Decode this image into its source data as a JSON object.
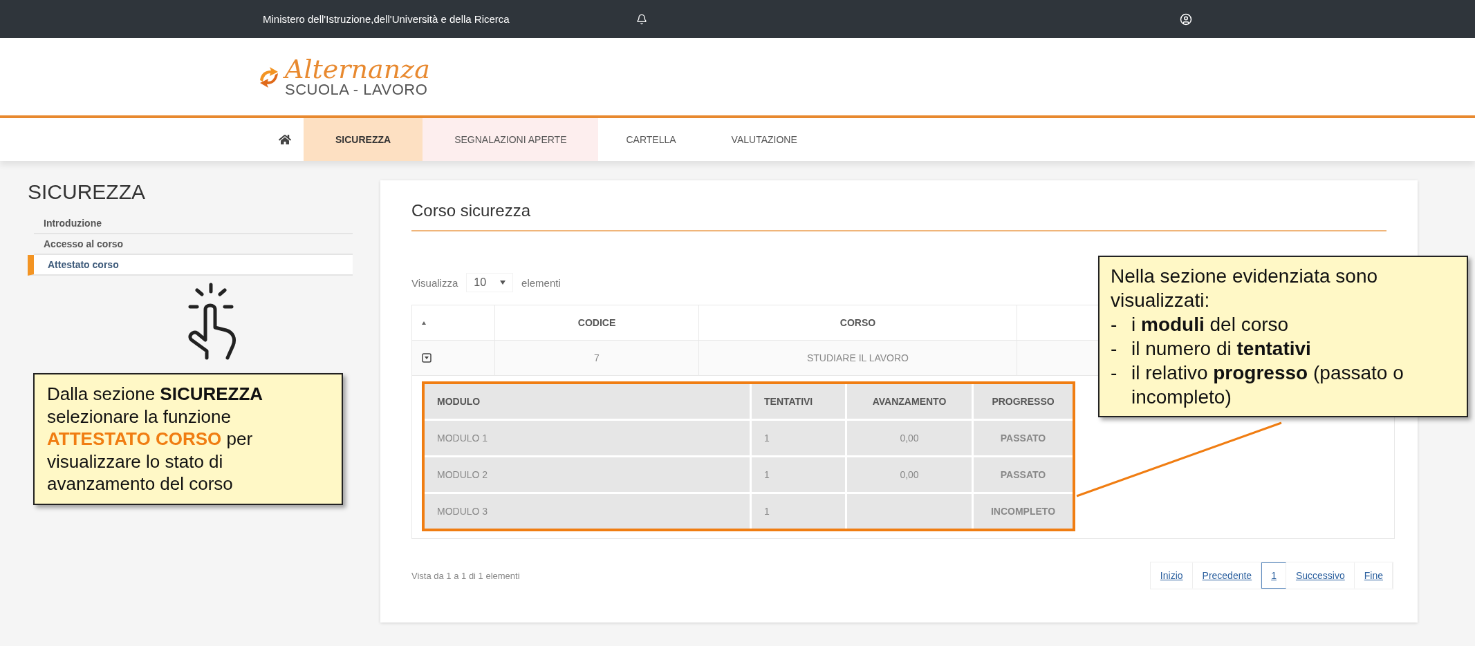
{
  "top_bar": {
    "ministry": "Ministero dell'Istruzione,dell'Università e della Ricerca"
  },
  "logo": {
    "script": "Alternanza",
    "subtitle": "SCUOLA - LAVORO"
  },
  "nav": [
    {
      "label": "SICUREZZA",
      "selected": true,
      "highlighted": false
    },
    {
      "label": "SEGNALAZIONI APERTE",
      "selected": false,
      "highlighted": true
    },
    {
      "label": "CARTELLA",
      "selected": false,
      "highlighted": false
    },
    {
      "label": "VALUTAZIONE",
      "selected": false,
      "highlighted": false
    }
  ],
  "sidebar": {
    "title": "SICUREZZA",
    "items": [
      {
        "label": "Introduzione",
        "selected": false
      },
      {
        "label": "Accesso al corso",
        "selected": false
      },
      {
        "label": "Attestato corso",
        "selected": true
      }
    ]
  },
  "card": {
    "title": "Corso sicurezza",
    "page_size": {
      "before": "Visualizza",
      "value": "10",
      "after": "elementi"
    },
    "table": {
      "columns": [
        "CODICE",
        "CORSO"
      ],
      "rows": [
        {
          "expanded": true,
          "cells": [
            "7",
            "STUDIARE IL LAVORO"
          ],
          "modules": {
            "columns": [
              "MODULO",
              "TENTATIVI",
              "AVANZAMENTO",
              "PROGRESSO"
            ],
            "rows": [
              [
                "MODULO 1",
                "1",
                "0,00",
                "PASSATO"
              ],
              [
                "MODULO 2",
                "1",
                "0,00",
                "PASSATO"
              ],
              [
                "MODULO 3",
                "1",
                "",
                "INCOMPLETO"
              ]
            ]
          }
        }
      ]
    },
    "footer": "Vista da 1 a 1 di 1 elementi",
    "pagination": [
      {
        "label": "Inizio",
        "selected": false
      },
      {
        "label": "Precedente",
        "selected": false
      },
      {
        "label": "1",
        "selected": true
      },
      {
        "label": "Successivo",
        "selected": false
      },
      {
        "label": "Fine",
        "selected": false
      }
    ]
  },
  "callouts": [
    {
      "segments": [
        {
          "text": "Dalla sezione ",
          "kind": "plain"
        },
        {
          "text": "SICUREZZA",
          "kind": "bold"
        },
        {
          "text": " selezionare la funzione ",
          "kind": "plain"
        },
        {
          "text": "ATTESTATO CORSO",
          "kind": "accent"
        },
        {
          "text": " per visualizzare lo stato di avanzamento del corso",
          "kind": "plain"
        }
      ]
    },
    {
      "intro": "Nella sezione evidenziata sono visualizzati:",
      "bullets": [
        {
          "marker": "-",
          "text": "i **moduli** del corso"
        },
        {
          "marker": "-",
          "text": "il numero di **tentativi**"
        },
        {
          "marker": "-",
          "text": "il relativo **progresso** (passato o incompleto)"
        }
      ]
    }
  ]
}
